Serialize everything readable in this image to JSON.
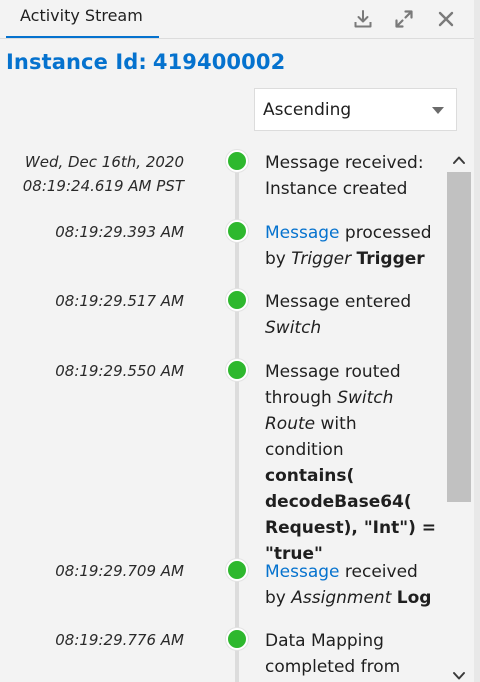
{
  "header": {
    "tab_label": "Activity Stream",
    "icons": [
      "download-icon",
      "expand-icon",
      "close-icon"
    ]
  },
  "instance": {
    "label": "Instance Id:",
    "id": "419400002"
  },
  "sort": {
    "value": "Ascending"
  },
  "status_color": "#2eb82e",
  "accent_color": "#0572ce",
  "events": [
    {
      "ts_line1": "Wed, Dec 16th, 2020",
      "ts_line2": "08:19:24.619 AM PST",
      "text_a": "Message received:",
      "text_b": "Instance created"
    },
    {
      "ts_line1": "08:19:29.393 AM",
      "link": "Message",
      "text_a": " processed",
      "text_b": "by ",
      "italic": "Trigger",
      "bold": "Trigger"
    },
    {
      "ts_line1": "08:19:29.517 AM",
      "text_a": "Message entered",
      "italic": "Switch"
    },
    {
      "ts_line1": "08:19:29.550 AM",
      "text_a": "Message routed",
      "text_b": "through ",
      "italic": "Switch Route",
      "text_c": " with condition ",
      "bold": "contains( decodeBase64( Request), \"Int\") = \"true\""
    },
    {
      "ts_line1": "08:19:29.709 AM",
      "link": "Message",
      "text_a": " received",
      "text_b": "by ",
      "italic": "Assignment",
      "bold": "Log"
    },
    {
      "ts_line1": "08:19:29.776 AM",
      "text_a": "Data Mapping",
      "text_b": "completed from"
    }
  ]
}
